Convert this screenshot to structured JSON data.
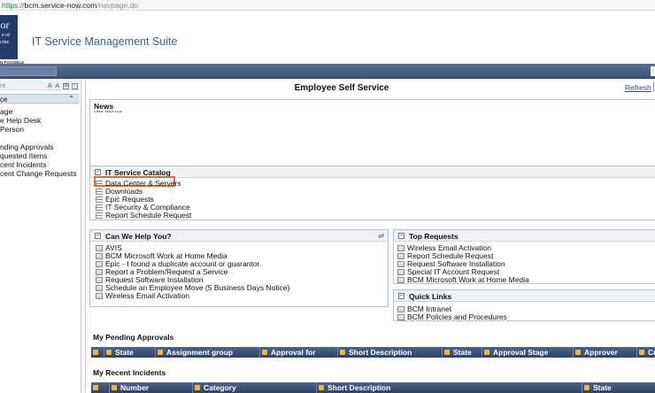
{
  "browser": {
    "url_scheme": "https://",
    "url_host": "bcm.service-now.com",
    "url_path": "/navpage.do"
  },
  "header": {
    "logo_line1": "lor",
    "logo_line2": "e of",
    "logo_line3": "cine",
    "logo_tag": "N POSSIBLE",
    "app_title": "IT Service Management Suite"
  },
  "sidebar": {
    "filter_label": "nt",
    "tools": "A A",
    "section_label": "ce",
    "items": [
      "age",
      "e Help Desk",
      "Person",
      "nding Approvals",
      "quested Items",
      "cent Incidents",
      "cent Change Requests"
    ]
  },
  "main": {
    "title": "Employee Self Service",
    "refresh_label": "Refresh"
  },
  "news": {
    "title": "News",
    "empty_text": "No items"
  },
  "catalog": {
    "title": "IT Service Catalog",
    "items": [
      "Data Center & Servers",
      "Downloads",
      "Epic Requests",
      "IT Security & Compliance",
      "Report Schedule Request"
    ]
  },
  "help": {
    "title": "Can We Help You?",
    "items": [
      "AVIS",
      "BCM Microsoft Work at Home Media",
      "Epic - I found a duplicate account or guarantor.",
      "Report a Problem/Request a Service",
      "Request Software Installation",
      "Schedule an Employee Move (5 Business Days Notice)",
      "Wireless Email Activation"
    ]
  },
  "top_requests": {
    "title": "Top Requests",
    "items": [
      "Wireless Email Activation",
      "Report Schedule Request",
      "Request Software Installation",
      "Special IT Account Request",
      "BCM Microsoft Work at Home Media"
    ]
  },
  "quick_links": {
    "title": "Quick Links",
    "items": [
      "BCM Intranet",
      "BCM Policies and Procedures"
    ]
  },
  "pending_approvals": {
    "title": "My Pending Approvals",
    "columns": [
      "State",
      "Assignment group",
      "Approval for",
      "Short Description",
      "State",
      "Approval Stage",
      "Approver",
      "Cre"
    ]
  },
  "recent_incidents": {
    "title": "My Recent Incidents",
    "columns": [
      "Number",
      "Category",
      "Short Description",
      "State"
    ]
  }
}
